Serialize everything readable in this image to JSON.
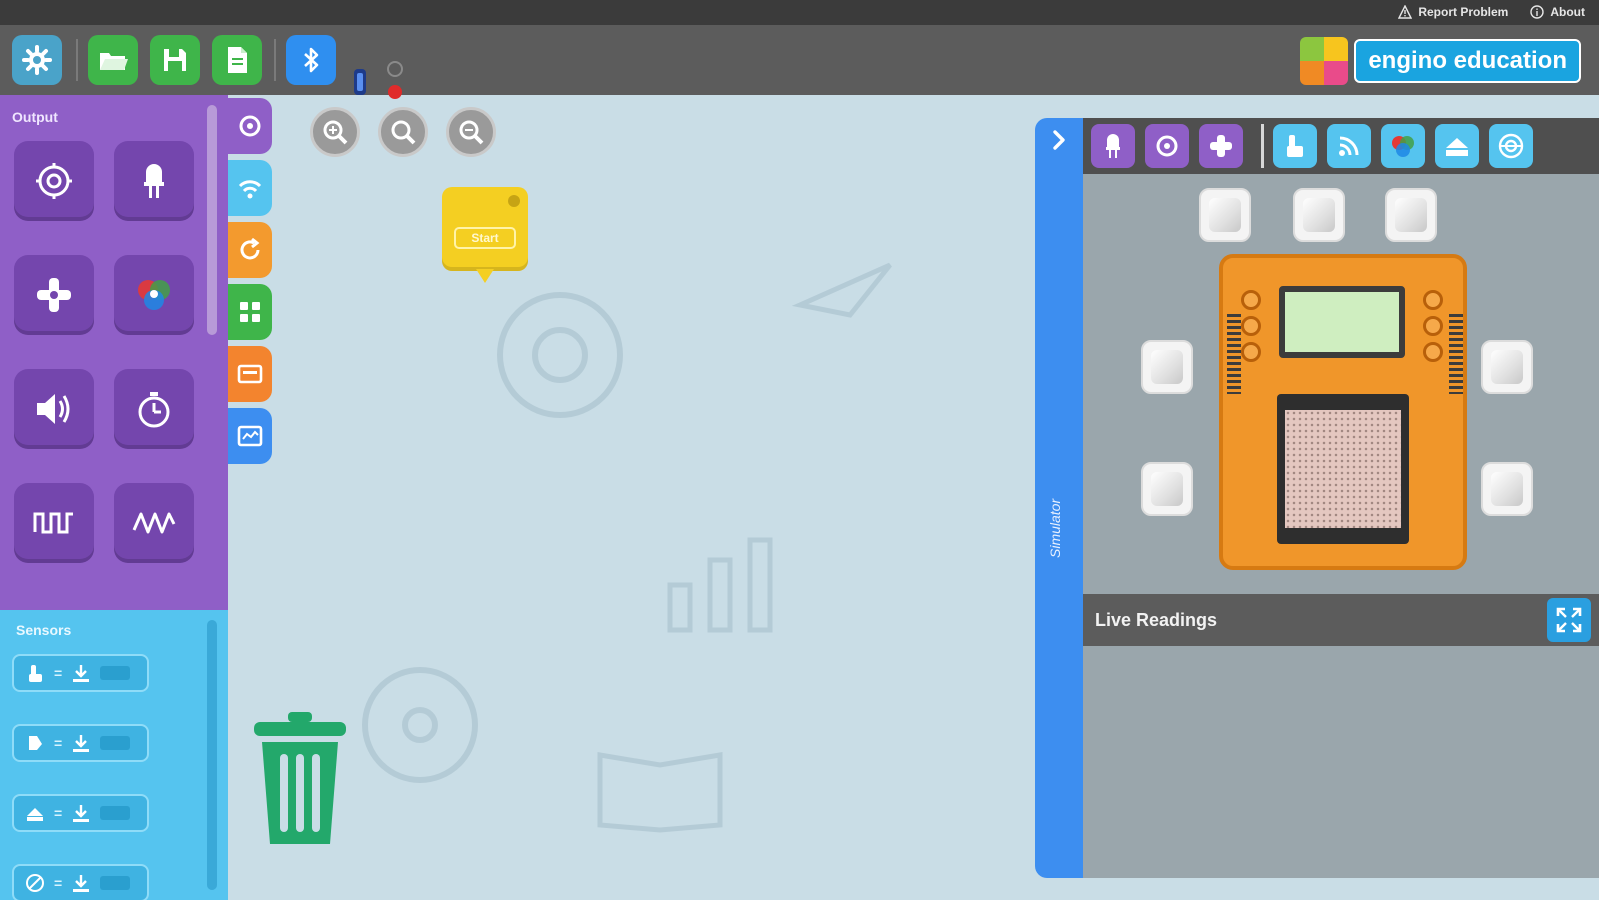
{
  "topbar": {
    "report_label": "Report Problem",
    "about_label": "About"
  },
  "toolbar": {
    "buttons": [
      {
        "name": "settings",
        "color": "#4aa3c9"
      },
      {
        "name": "open",
        "color": "#3fb54a"
      },
      {
        "name": "save",
        "color": "#3fb54a"
      },
      {
        "name": "new",
        "color": "#3fb54a"
      },
      {
        "name": "bluetooth",
        "color": "#2f8ff0"
      }
    ]
  },
  "brand": {
    "text": "engino education"
  },
  "palette": {
    "output": {
      "title": "Output",
      "blocks": [
        "motor-icon",
        "led-icon",
        "servo-icon",
        "rgb-led-icon",
        "speaker-icon",
        "timer-icon",
        "square-wave-icon",
        "sine-wave-icon"
      ],
      "color": "#8f5fc7"
    },
    "sensors": {
      "title": "Sensors",
      "rows": [
        "touch-sensor-icon",
        "light-sensor-icon",
        "ir-sensor-icon",
        "ultrasonic-sensor-icon"
      ],
      "color": "#55c4ef"
    },
    "categories": [
      {
        "name": "output",
        "color": "#8f5fc7"
      },
      {
        "name": "sensors",
        "color": "#55c4ef"
      },
      {
        "name": "control",
        "color": "#f39a2e"
      },
      {
        "name": "logic",
        "color": "#3fb54a"
      },
      {
        "name": "variables",
        "color": "#f3842e"
      },
      {
        "name": "display",
        "color": "#3d8ef0"
      }
    ]
  },
  "canvas": {
    "start_block_label": "Start",
    "zoom_buttons": [
      "zoom-in",
      "zoom-reset",
      "zoom-out"
    ]
  },
  "simulator": {
    "tab_label": "Simulator",
    "toolbar_icons": [
      "led-icon",
      "motor-icon",
      "servo-icon",
      "touch-sensor-icon",
      "light-sensor-icon",
      "rgb-sensor-icon",
      "ir-sensor-icon",
      "ultrasonic-sensor-icon"
    ],
    "live_readings_label": "Live Readings"
  }
}
